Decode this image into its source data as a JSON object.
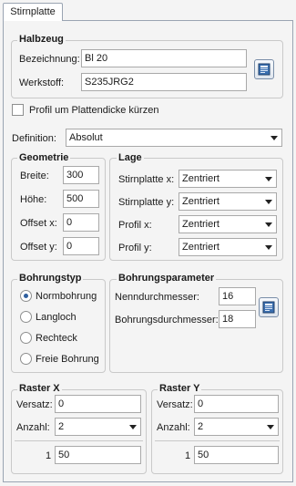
{
  "tab": {
    "label": "Stirnplatte"
  },
  "halbzeug": {
    "title": "Halbzeug",
    "bezeichnung_label": "Bezeichnung:",
    "bezeichnung_value": "Bl 20",
    "werkstoff_label": "Werkstoff:",
    "werkstoff_value": "S235JRG2",
    "catalog_icon": "catalog-book-icon"
  },
  "profil_checkbox": {
    "label": "Profil um Plattendicke kürzen",
    "checked": false
  },
  "definition": {
    "label": "Definition:",
    "value": "Absolut"
  },
  "geometrie": {
    "title": "Geometrie",
    "breite_label": "Breite:",
    "breite_value": "300",
    "hoehe_label": "Höhe:",
    "hoehe_value": "500",
    "offset_x_label": "Offset x:",
    "offset_x_value": "0",
    "offset_y_label": "Offset y:",
    "offset_y_value": "0"
  },
  "lage": {
    "title": "Lage",
    "stirnplatte_x_label": "Stirnplatte x:",
    "stirnplatte_x_value": "Zentriert",
    "stirnplatte_y_label": "Stirnplatte y:",
    "stirnplatte_y_value": "Zentriert",
    "profil_x_label": "Profil x:",
    "profil_x_value": "Zentriert",
    "profil_y_label": "Profil y:",
    "profil_y_value": "Zentriert"
  },
  "bohrungstyp": {
    "title": "Bohrungstyp",
    "options": [
      "Normbohrung",
      "Langloch",
      "Rechteck",
      "Freie Bohrung"
    ],
    "selected": "Normbohrung"
  },
  "bohrungsparameter": {
    "title": "Bohrungsparameter",
    "nenndurchmesser_label": "Nenndurchmesser:",
    "nenndurchmesser_value": "16",
    "bohrungsdurchmesser_label": "Bohrungsdurchmesser:",
    "bohrungsdurchmesser_value": "18"
  },
  "raster_x": {
    "title": "Raster X",
    "versatz_label": "Versatz:",
    "versatz_value": "0",
    "anzahl_label": "Anzahl:",
    "anzahl_value": "2",
    "row_index": "1",
    "row_value": "50"
  },
  "raster_y": {
    "title": "Raster Y",
    "versatz_label": "Versatz:",
    "versatz_value": "0",
    "anzahl_label": "Anzahl:",
    "anzahl_value": "2",
    "row_index": "1",
    "row_value": "50"
  }
}
